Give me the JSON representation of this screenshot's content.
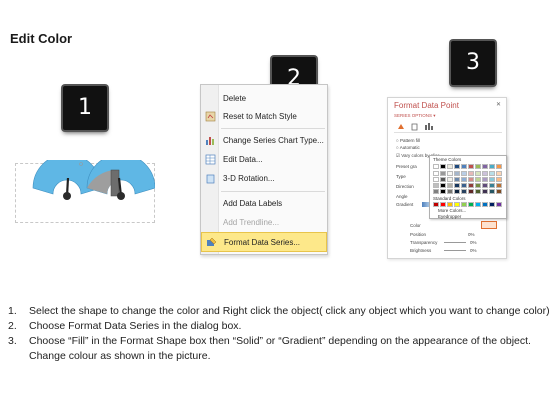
{
  "title": "Edit Color",
  "badges": [
    "1",
    "2",
    "3"
  ],
  "context_menu": {
    "items": [
      {
        "label": "Delete",
        "icon": "delete-icon",
        "enabled": true
      },
      {
        "label": "Reset to Match Style",
        "icon": "reset-style-icon",
        "enabled": true
      },
      {
        "label": "Change Series Chart Type...",
        "icon": "chart-type-icon",
        "enabled": true
      },
      {
        "label": "Edit Data...",
        "icon": "edit-data-icon",
        "enabled": true
      },
      {
        "label": "3-D Rotation...",
        "icon": "rotation-icon",
        "enabled": true
      },
      {
        "label": "Add Data Labels",
        "icon": "",
        "enabled": true
      },
      {
        "label": "Add Trendline...",
        "icon": "",
        "enabled": false
      },
      {
        "label": "Format Data Series...",
        "icon": "format-series-icon",
        "enabled": true,
        "highlighted": true
      }
    ]
  },
  "format_pane": {
    "title": "Format Data Point",
    "subtitle": "SERIES OPTIONS ▾",
    "rows": [
      "Pattern fill",
      "Automatic",
      "Vary colors by slice",
      "Preset gra",
      "Type",
      "Direction",
      "Angle",
      "Gradient",
      "Color",
      "Position",
      "Transparency",
      "Brightness"
    ],
    "percent": [
      "0%",
      "0%",
      "0%"
    ],
    "theme_colors_label": "Theme Colors",
    "standard_colors_label": "Standard Colors",
    "more_colors": "More Colors...",
    "eyedropper": "Eyedropper",
    "theme_colors": [
      "#ffffff",
      "#000000",
      "#eeece1",
      "#1f497d",
      "#4f81bd",
      "#c0504d",
      "#9bbb59",
      "#8064a2",
      "#4bacc6",
      "#f79646"
    ],
    "standard_colors": [
      "#c00000",
      "#ff0000",
      "#ffc000",
      "#ffff00",
      "#92d050",
      "#00b050",
      "#00b0f0",
      "#0070c0",
      "#002060",
      "#7030a0"
    ]
  },
  "gauge_colors": {
    "fill": "#5fb7e5",
    "dark": "#2b2b2b",
    "gray": "#9e9e9e"
  },
  "instructions": [
    {
      "num": "1.",
      "text": "Select the shape to change the color and Right click the object( click any object which you want to change color)"
    },
    {
      "num": "2.",
      "text": "Choose Format Data Series in the dialog box."
    },
    {
      "num": "3.",
      "text": "Choose “Fill” in the Format Shape box then “Solid” or “Gradient” depending on the appearance of the object. Change colour as shown in the picture."
    }
  ]
}
